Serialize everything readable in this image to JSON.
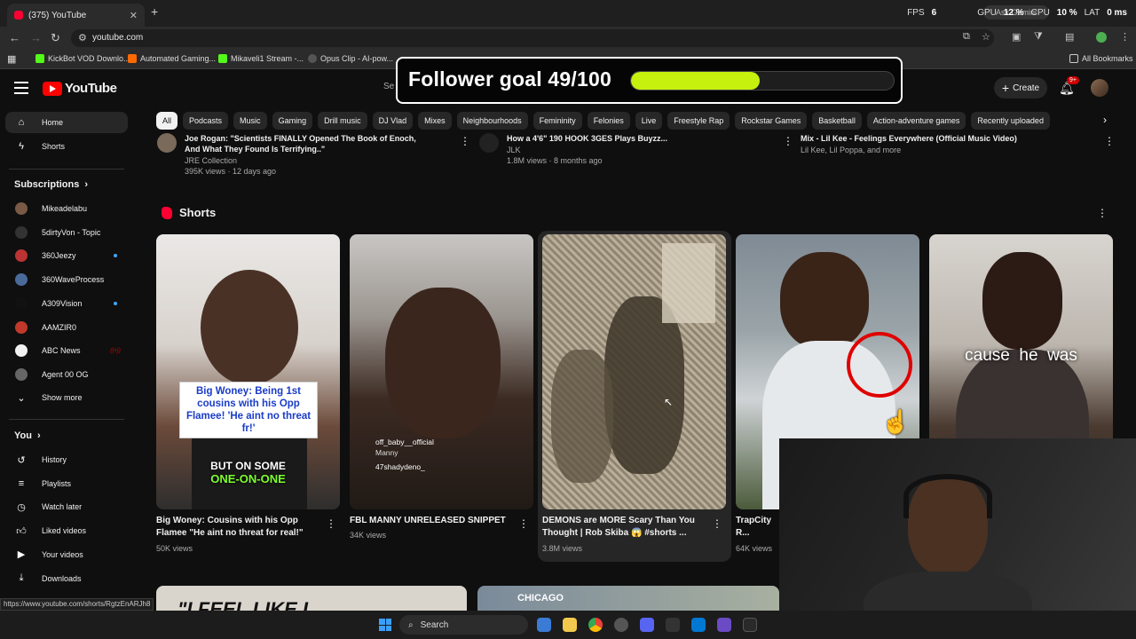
{
  "browser": {
    "tab_title": "(375) YouTube",
    "url": "youtube.com",
    "new_tab": "+",
    "status_url": "https://www.youtube.com/shorts/RgtzEnARJh8",
    "bookmarks": [
      {
        "label": "KickBot VOD Downlo...",
        "color": "#53fc18"
      },
      {
        "label": "Automated Gaming...",
        "color": "#ff6a00"
      },
      {
        "label": "Mikaveli1 Stream -...",
        "color": "#53fc18"
      },
      {
        "label": "Opus Clip - AI-pow...",
        "color": "#222222"
      }
    ],
    "all_bookmarks": "All Bookmarks",
    "gemini": "Ask Gemini"
  },
  "stats_overlay": {
    "fps_label": "FPS",
    "fps_value": "6",
    "gpu_label": "GPU",
    "gpu_value": "12 %",
    "cpu_label": "CPU",
    "cpu_value": "10 %",
    "lat_label": "LAT",
    "lat_value": "0 ms"
  },
  "follower_goal": {
    "label": "Follower goal 49/100",
    "current": 49,
    "target": 100,
    "bar_color": "#c6f10e"
  },
  "header": {
    "logo_text": "YouTube",
    "search_fragment": "Se",
    "create_label": "Create",
    "notif_badge": "9+"
  },
  "chips": [
    "All",
    "Podcasts",
    "Music",
    "Gaming",
    "Drill music",
    "DJ Vlad",
    "Mixes",
    "Neighbourhoods",
    "Femininity",
    "Felonies",
    "Live",
    "Freestyle Rap",
    "Rockstar Games",
    "Basketball",
    "Action-adventure games",
    "Recently uploaded"
  ],
  "sidebar": {
    "main": [
      {
        "label": "Home",
        "icon": "home-icon"
      },
      {
        "label": "Shorts",
        "icon": "shorts-icon"
      }
    ],
    "subscriptions_title": "Subscriptions",
    "subscriptions": [
      {
        "label": "Mikeadelabu",
        "color": "#7a5a45",
        "dot": false,
        "live": false
      },
      {
        "label": "5dirtyVon - Topic",
        "color": "#333333",
        "dot": false,
        "live": false
      },
      {
        "label": "360Jeezy",
        "color": "#b33",
        "dot": true,
        "live": false
      },
      {
        "label": "360WaveProcess",
        "color": "#4a6a9a",
        "dot": false,
        "live": false
      },
      {
        "label": "A309Vision",
        "color": "#111111",
        "dot": true,
        "live": false
      },
      {
        "label": "AAMZIR0",
        "color": "#c0392b",
        "dot": false,
        "live": false
      },
      {
        "label": "ABC News",
        "color": "#f1f1f1",
        "dot": false,
        "live": true
      },
      {
        "label": "Agent 00 OG",
        "color": "#666666",
        "dot": false,
        "live": false
      }
    ],
    "show_more": "Show more",
    "you_title": "You",
    "you_items": [
      {
        "label": "History",
        "icon": "history-icon"
      },
      {
        "label": "Playlists",
        "icon": "playlists-icon"
      },
      {
        "label": "Watch later",
        "icon": "watch-later-icon"
      },
      {
        "label": "Liked videos",
        "icon": "liked-icon"
      },
      {
        "label": "Your videos",
        "icon": "your-videos-icon"
      },
      {
        "label": "Downloads",
        "icon": "downloads-icon"
      }
    ]
  },
  "previous_row": [
    {
      "title_line1": "Joe Rogan: \"Scientists FINALLY Opened The Book of Enoch,",
      "title_line2": "And What They Found Is Terrifying..\"",
      "channel": "JRE Collection",
      "meta": "395K views · 12 days ago"
    },
    {
      "title_line1": "How a 4'6\" 190 HOOK 3GES Plays Buyzz...",
      "channel": "JLK",
      "meta": "1.8M views · 8 months ago"
    },
    {
      "title_line1": "Mix - Lil Kee - Feelings Everywhere (Official Music Video)",
      "channel": "Lil Kee, Lil Poppa, and more",
      "meta": ""
    }
  ],
  "shorts": {
    "title": "Shorts",
    "items": [
      {
        "title": "Big Woney: Cousins with his Opp Flamee \"He aint no threat for real!\"",
        "views": "50K views",
        "caption": "Big Woney: Being 1st cousins with his Opp Flamee! 'He aint no threat fr!'",
        "caption2": "BUT ON SOME",
        "caption3": "ONE-ON-ONE"
      },
      {
        "title": "FBL MANNY UNRELEASED SNIPPET",
        "views": "34K views",
        "comment1": "off_baby__official",
        "comment1b": "Manny",
        "comment2": "47shadydeno_"
      },
      {
        "title": "DEMONS are MORE Scary Than You Thought | Rob Skiba 😱 #shorts ...",
        "views": "3.8M views"
      },
      {
        "title": "TrapCity R... Jumped W...",
        "views": "64K views"
      },
      {
        "title": "",
        "views": "",
        "caption": "cause  he  was"
      }
    ]
  },
  "peek": {
    "text1": "\"I FEEL LIKE I",
    "text2": "CHICAGO"
  },
  "taskbar": {
    "search": "Search"
  }
}
